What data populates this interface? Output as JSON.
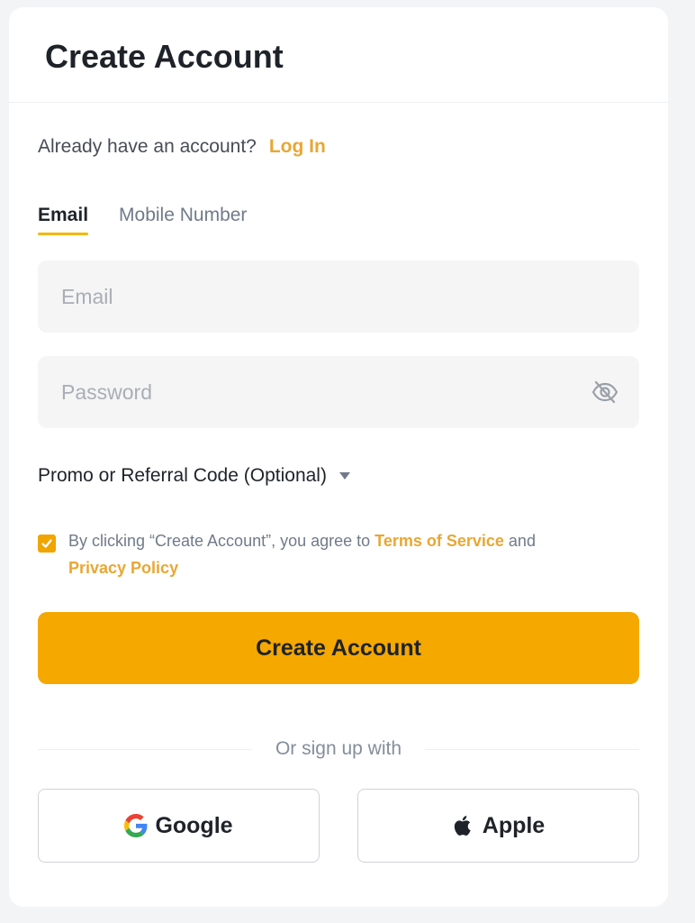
{
  "header": {
    "title": "Create Account"
  },
  "login": {
    "prompt": "Already have an account?",
    "link": "Log In"
  },
  "tabs": [
    {
      "label": "Email",
      "active": true
    },
    {
      "label": "Mobile Number",
      "active": false
    }
  ],
  "form": {
    "email": {
      "value": "",
      "placeholder": "Email"
    },
    "password": {
      "value": "",
      "placeholder": "Password"
    },
    "promo_label": "Promo or Referral Code (Optional)"
  },
  "terms": {
    "checked": true,
    "prefix": "By clicking “Create Account”, you agree to ",
    "tos_link": "Terms of Service",
    "conjunction": " and",
    "privacy_link": "Privacy Policy"
  },
  "submit_label": "Create Account",
  "divider_label": "Or sign up with",
  "social": {
    "google_label": "Google",
    "apple_label": "Apple"
  },
  "colors": {
    "accent": "#f5a800",
    "link": "#e8a735",
    "text": "#1e2329",
    "muted": "#707a8a",
    "field_bg": "#f5f5f5"
  },
  "icons": [
    "eye-slash-icon",
    "chevron-down-icon",
    "checkmark-icon",
    "google-icon",
    "apple-icon"
  ]
}
